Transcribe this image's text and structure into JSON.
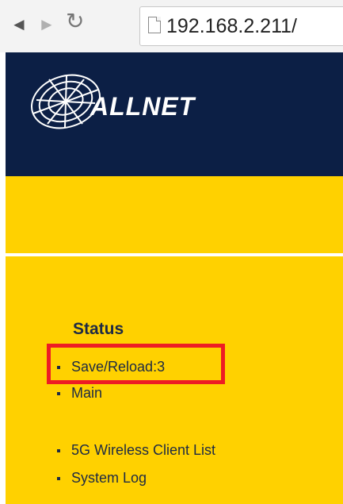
{
  "browser": {
    "back_icon": "◄",
    "forward_icon": "►",
    "reload_icon": "↻",
    "url": "192.168.2.211/"
  },
  "header": {
    "logo": "ALLNET"
  },
  "menu": {
    "heading": "Status",
    "items": [
      {
        "label": "Save/Reload:3",
        "highlighted": true
      },
      {
        "label": "Main"
      },
      {
        "label": "5G Wireless Client List"
      },
      {
        "label": "System Log"
      }
    ]
  },
  "colors": {
    "header_bg": "#0c1f45",
    "menu_bg": "#ffd100",
    "highlight": "#ee1c24"
  }
}
